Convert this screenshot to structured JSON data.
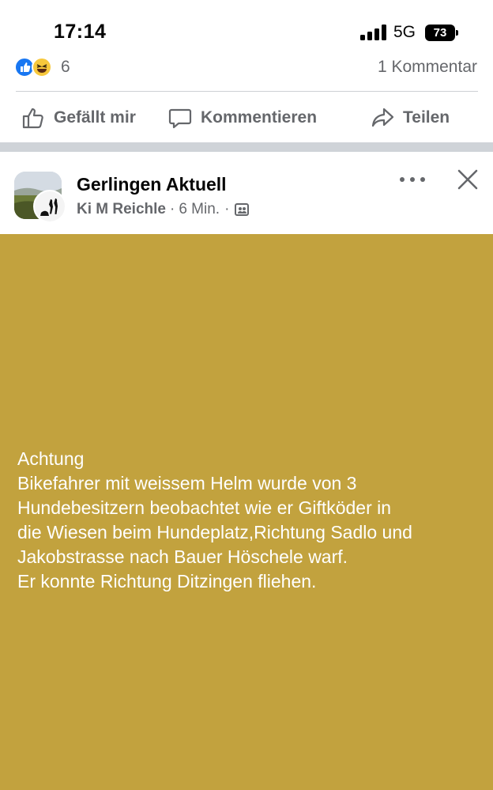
{
  "status_bar": {
    "time": "17:14",
    "network": "5G",
    "battery": "73"
  },
  "reactions": {
    "count": "6",
    "comments": "1 Kommentar"
  },
  "actions": {
    "like": "Gefällt mir",
    "comment": "Kommentieren",
    "share": "Teilen"
  },
  "post": {
    "group_name": "Gerlingen Aktuell",
    "author": "Ki M Reichle",
    "time_ago": "6 Min.",
    "separator": "·",
    "background_color": "#c2a23e",
    "text_lines": [
      "Achtung",
      "Bikefahrer mit weissem Helm wurde von 3",
      "Hundebesitzern beobachtet wie er Giftköder in",
      "die Wiesen beim Hundeplatz,Richtung Sadlo und",
      "Jakobstrasse nach Bauer Höschele warf.",
      "Er konnte Richtung Ditzingen fliehen."
    ]
  }
}
